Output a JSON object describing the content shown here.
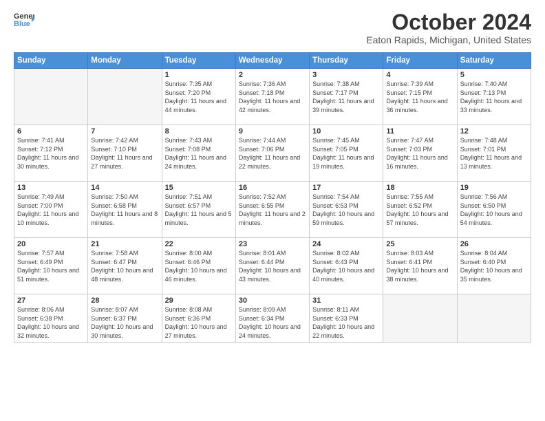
{
  "logo": {
    "line1": "General",
    "line2": "Blue",
    "arrow_color": "#4a90d9"
  },
  "title": "October 2024",
  "location": "Eaton Rapids, Michigan, United States",
  "weekdays": [
    "Sunday",
    "Monday",
    "Tuesday",
    "Wednesday",
    "Thursday",
    "Friday",
    "Saturday"
  ],
  "weeks": [
    [
      {
        "day": "",
        "info": ""
      },
      {
        "day": "",
        "info": ""
      },
      {
        "day": "1",
        "info": "Sunrise: 7:35 AM\nSunset: 7:20 PM\nDaylight: 11 hours and 44 minutes."
      },
      {
        "day": "2",
        "info": "Sunrise: 7:36 AM\nSunset: 7:18 PM\nDaylight: 11 hours and 42 minutes."
      },
      {
        "day": "3",
        "info": "Sunrise: 7:38 AM\nSunset: 7:17 PM\nDaylight: 11 hours and 39 minutes."
      },
      {
        "day": "4",
        "info": "Sunrise: 7:39 AM\nSunset: 7:15 PM\nDaylight: 11 hours and 36 minutes."
      },
      {
        "day": "5",
        "info": "Sunrise: 7:40 AM\nSunset: 7:13 PM\nDaylight: 11 hours and 33 minutes."
      }
    ],
    [
      {
        "day": "6",
        "info": "Sunrise: 7:41 AM\nSunset: 7:12 PM\nDaylight: 11 hours and 30 minutes."
      },
      {
        "day": "7",
        "info": "Sunrise: 7:42 AM\nSunset: 7:10 PM\nDaylight: 11 hours and 27 minutes."
      },
      {
        "day": "8",
        "info": "Sunrise: 7:43 AM\nSunset: 7:08 PM\nDaylight: 11 hours and 24 minutes."
      },
      {
        "day": "9",
        "info": "Sunrise: 7:44 AM\nSunset: 7:06 PM\nDaylight: 11 hours and 22 minutes."
      },
      {
        "day": "10",
        "info": "Sunrise: 7:45 AM\nSunset: 7:05 PM\nDaylight: 11 hours and 19 minutes."
      },
      {
        "day": "11",
        "info": "Sunrise: 7:47 AM\nSunset: 7:03 PM\nDaylight: 11 hours and 16 minutes."
      },
      {
        "day": "12",
        "info": "Sunrise: 7:48 AM\nSunset: 7:01 PM\nDaylight: 11 hours and 13 minutes."
      }
    ],
    [
      {
        "day": "13",
        "info": "Sunrise: 7:49 AM\nSunset: 7:00 PM\nDaylight: 11 hours and 10 minutes."
      },
      {
        "day": "14",
        "info": "Sunrise: 7:50 AM\nSunset: 6:58 PM\nDaylight: 11 hours and 8 minutes."
      },
      {
        "day": "15",
        "info": "Sunrise: 7:51 AM\nSunset: 6:57 PM\nDaylight: 11 hours and 5 minutes."
      },
      {
        "day": "16",
        "info": "Sunrise: 7:52 AM\nSunset: 6:55 PM\nDaylight: 11 hours and 2 minutes."
      },
      {
        "day": "17",
        "info": "Sunrise: 7:54 AM\nSunset: 6:53 PM\nDaylight: 10 hours and 59 minutes."
      },
      {
        "day": "18",
        "info": "Sunrise: 7:55 AM\nSunset: 6:52 PM\nDaylight: 10 hours and 57 minutes."
      },
      {
        "day": "19",
        "info": "Sunrise: 7:56 AM\nSunset: 6:50 PM\nDaylight: 10 hours and 54 minutes."
      }
    ],
    [
      {
        "day": "20",
        "info": "Sunrise: 7:57 AM\nSunset: 6:49 PM\nDaylight: 10 hours and 51 minutes."
      },
      {
        "day": "21",
        "info": "Sunrise: 7:58 AM\nSunset: 6:47 PM\nDaylight: 10 hours and 48 minutes."
      },
      {
        "day": "22",
        "info": "Sunrise: 8:00 AM\nSunset: 6:46 PM\nDaylight: 10 hours and 46 minutes."
      },
      {
        "day": "23",
        "info": "Sunrise: 8:01 AM\nSunset: 6:44 PM\nDaylight: 10 hours and 43 minutes."
      },
      {
        "day": "24",
        "info": "Sunrise: 8:02 AM\nSunset: 6:43 PM\nDaylight: 10 hours and 40 minutes."
      },
      {
        "day": "25",
        "info": "Sunrise: 8:03 AM\nSunset: 6:41 PM\nDaylight: 10 hours and 38 minutes."
      },
      {
        "day": "26",
        "info": "Sunrise: 8:04 AM\nSunset: 6:40 PM\nDaylight: 10 hours and 35 minutes."
      }
    ],
    [
      {
        "day": "27",
        "info": "Sunrise: 8:06 AM\nSunset: 6:38 PM\nDaylight: 10 hours and 32 minutes."
      },
      {
        "day": "28",
        "info": "Sunrise: 8:07 AM\nSunset: 6:37 PM\nDaylight: 10 hours and 30 minutes."
      },
      {
        "day": "29",
        "info": "Sunrise: 8:08 AM\nSunset: 6:36 PM\nDaylight: 10 hours and 27 minutes."
      },
      {
        "day": "30",
        "info": "Sunrise: 8:09 AM\nSunset: 6:34 PM\nDaylight: 10 hours and 24 minutes."
      },
      {
        "day": "31",
        "info": "Sunrise: 8:11 AM\nSunset: 6:33 PM\nDaylight: 10 hours and 22 minutes."
      },
      {
        "day": "",
        "info": ""
      },
      {
        "day": "",
        "info": ""
      }
    ]
  ]
}
